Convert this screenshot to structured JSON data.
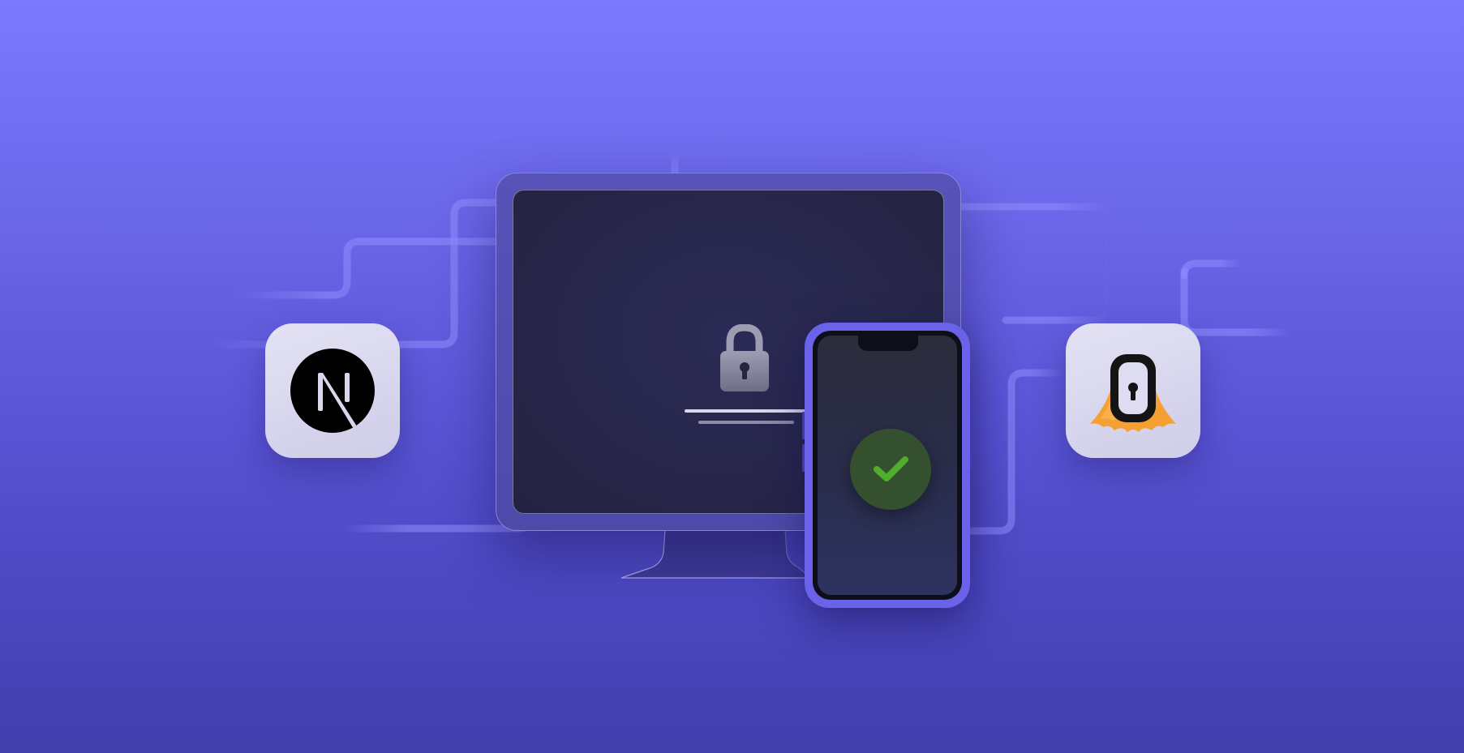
{
  "scene": {
    "background_top": "#7a7aff",
    "background_bottom": "#423fad"
  },
  "left_tile": {
    "icon": "nextjs-logo",
    "logo_letter": "N"
  },
  "right_tile": {
    "icon": "keyhole-cape-logo",
    "accent": "#f5a033"
  },
  "monitor": {
    "icon": "padlock-icon",
    "screen_color": "#27264a"
  },
  "phone": {
    "icon": "checkmark-icon",
    "check_color": "#4fae2c",
    "frame_color": "#6a63ea"
  }
}
